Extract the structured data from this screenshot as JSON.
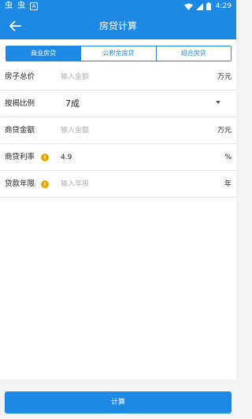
{
  "statusbar": {
    "left_icons": [
      "bug-icon",
      "bug-icon",
      "a-icon"
    ],
    "bug_glyph": "虫",
    "a_glyph": "A",
    "time": "4:29"
  },
  "appbar": {
    "title": "房贷计算",
    "background": "#1e88e5"
  },
  "tabs": [
    {
      "label": "商业房贷",
      "active": true
    },
    {
      "label": "公积金房贷",
      "active": false
    },
    {
      "label": "组合房贷",
      "active": false
    }
  ],
  "form": {
    "total_price": {
      "label": "房子总价",
      "placeholder": "输入金额",
      "unit": "万元"
    },
    "down_ratio": {
      "label": "按揭比例",
      "value": "7成"
    },
    "loan_amount": {
      "label": "商贷金额",
      "placeholder": "输入金额",
      "unit": "万元"
    },
    "rate": {
      "label": "商贷利率",
      "value": "4.9",
      "unit": "%"
    },
    "years": {
      "label": "贷款年限",
      "placeholder": "输入年限",
      "unit": "年"
    }
  },
  "calculate_label": "计算",
  "accent_color": "#1e88e5",
  "warning_color": "#e0a800"
}
